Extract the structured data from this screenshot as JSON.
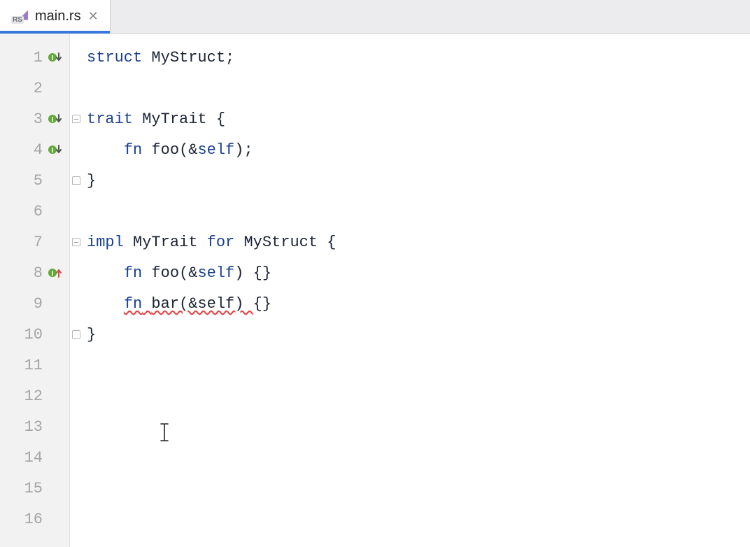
{
  "tab": {
    "filename": "main.rs",
    "icon_label": "RS"
  },
  "gutter": {
    "lines": [
      "1",
      "2",
      "3",
      "4",
      "5",
      "6",
      "7",
      "8",
      "9",
      "10",
      "11",
      "12",
      "13",
      "14",
      "15",
      "16"
    ],
    "markers": {
      "1": "impl-down",
      "3": "impl-down",
      "4": "impl-down",
      "8": "impl-up"
    },
    "folds": {
      "3": "open",
      "5": "close",
      "7": "open",
      "10": "close"
    }
  },
  "code": {
    "l1": {
      "kw": "struct",
      "id": "MyStruct",
      "tail": ";"
    },
    "l3": {
      "kw": "trait",
      "id": "MyTrait",
      "brace": " {"
    },
    "l4": {
      "indent": "    ",
      "kw": "fn",
      "name": "foo",
      "paren_open": "(",
      "amp": "&",
      "slf": "self",
      "paren_close": ");"
    },
    "l5": {
      "brace": "}"
    },
    "l7": {
      "kw1": "impl",
      "id1": "MyTrait",
      "kw2": "for",
      "id2": "MyStruct",
      "brace": " {"
    },
    "l8": {
      "indent": "    ",
      "kw": "fn",
      "name": "foo",
      "paren_open": "(",
      "amp": "&",
      "slf": "self",
      "paren_close": ") {}"
    },
    "l9": {
      "indent": "    ",
      "kw": "fn",
      "err_sig": "bar(&self) ",
      "tail": "{}"
    },
    "l10": {
      "brace": "}"
    }
  }
}
